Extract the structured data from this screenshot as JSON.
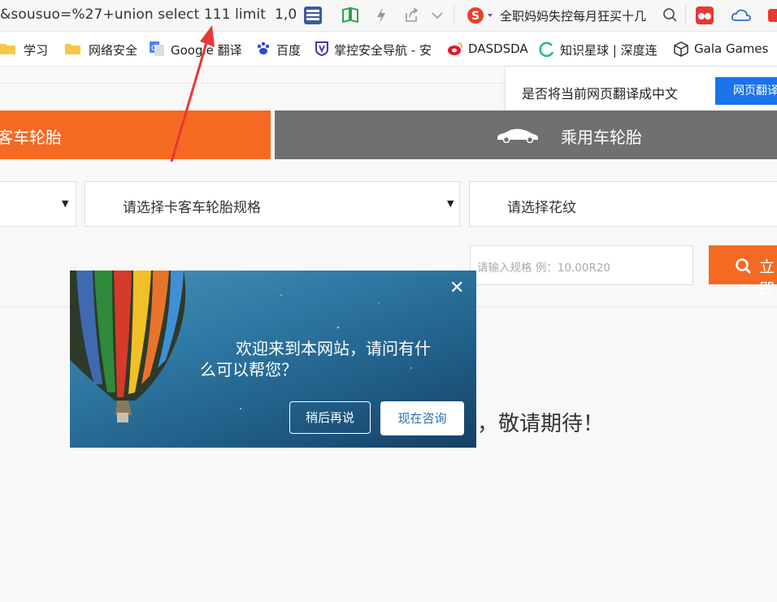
{
  "browser": {
    "url_text": "&sousuo=%27+union select 111 limit  1,0",
    "search_text": "全职妈妈失控每月狂买十几"
  },
  "bookmarks": [
    {
      "label": "学习"
    },
    {
      "label": "网络安全"
    },
    {
      "label": "Google 翻译"
    },
    {
      "label": "百度"
    },
    {
      "label": "掌控安全导航 - 安"
    },
    {
      "label": "DASDSDA"
    },
    {
      "label": "知识星球 | 深度连"
    },
    {
      "label": "Gala Games"
    }
  ],
  "translate_popup": {
    "prompt": "是否将当前网页翻译成中文",
    "button": "网页翻译"
  },
  "tabs": {
    "truck": "客车轮胎",
    "car": "乘用车轮胎"
  },
  "filters": {
    "select1_arrow": "▼",
    "spec_select": "请选择卡客车轮胎规格",
    "pattern_select": "请选择花纹"
  },
  "search": {
    "placeholder": "请输入规格 例：10.00R20",
    "button": "立即"
  },
  "notice": "，敬请期待！",
  "chat": {
    "close": "✕",
    "message_line1": "欢迎来到本网站，请问有什",
    "message_line2": "么可以帮您？",
    "later_button": "稍后再说",
    "consult_button": "现在咨询"
  },
  "colors": {
    "accent_orange": "#f46a23",
    "tab_gray": "#707070",
    "translate_blue": "#1a73e8",
    "annotation_red": "#e53935"
  }
}
